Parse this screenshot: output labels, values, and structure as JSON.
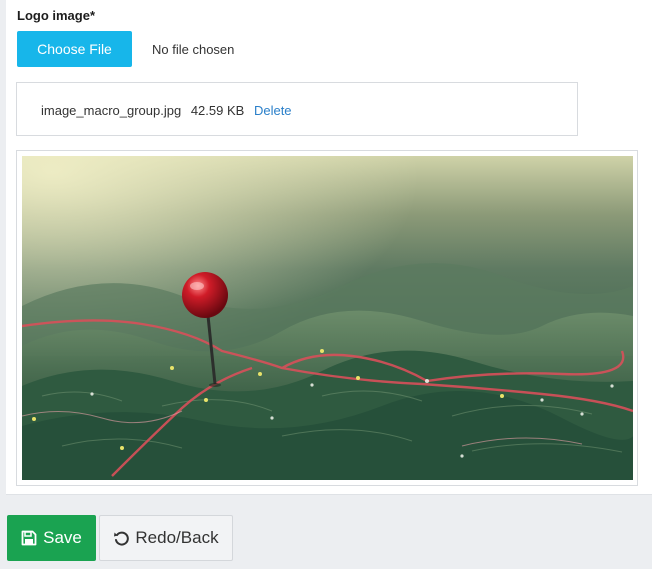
{
  "form": {
    "logo_label": "Logo image*",
    "choose_file_label": "Choose File",
    "no_file_text": "No file chosen",
    "file": {
      "name": "image_macro_group.jpg",
      "size": "42.59 KB",
      "delete_label": "Delete"
    }
  },
  "preview": {
    "icon": "map-pin-photo",
    "colors": {
      "terrain": "#3f6a4c",
      "route": "#d8505a",
      "pin": "#c3141f"
    }
  },
  "actions": {
    "save_label": "Save",
    "save_icon": "floppy-disk-icon",
    "back_label": "Redo/Back",
    "back_icon": "undo-icon",
    "save_color": "#1aa351"
  }
}
